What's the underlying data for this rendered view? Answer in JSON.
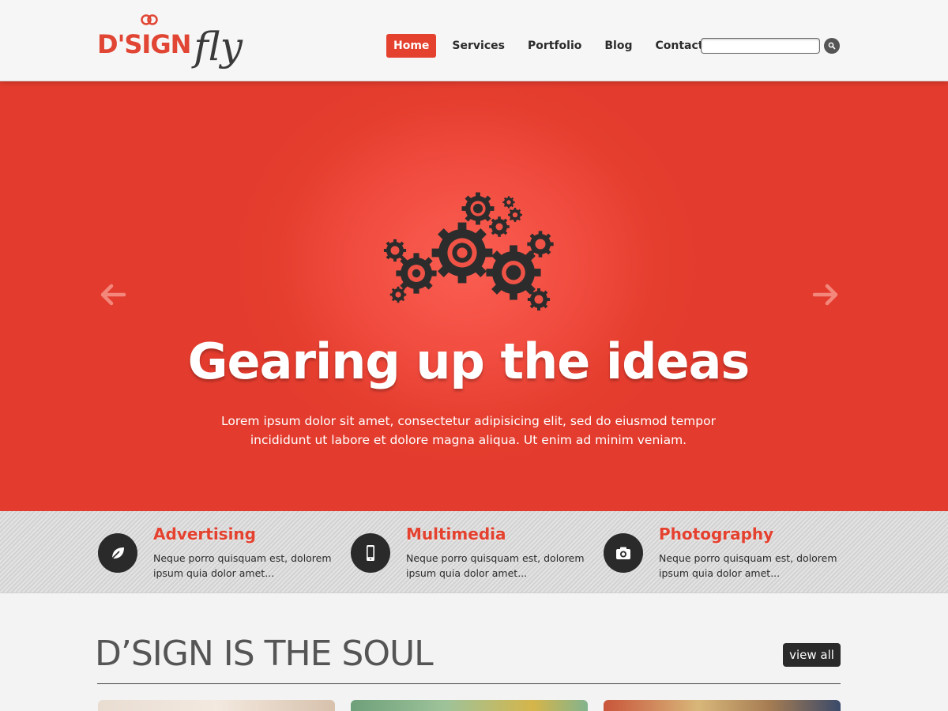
{
  "header": {
    "logo_mark": "D'SIGN",
    "logo_script": "fly",
    "nav": [
      {
        "label": "Home",
        "active": true
      },
      {
        "label": "Services",
        "active": false
      },
      {
        "label": "Portfolio",
        "active": false
      },
      {
        "label": "Blog",
        "active": false
      },
      {
        "label": "Contact",
        "active": false
      }
    ],
    "search": {
      "placeholder": "",
      "value": "",
      "icon": "search-icon"
    }
  },
  "hero": {
    "title": "Gearing up the ideas",
    "text": "Lorem ipsum dolor sit amet, consectetur adipisicing elit, sed do eiusmod tempor incididunt ut labore et dolore magna aliqua. Ut enim ad minim veniam.",
    "icon": "gears-icon",
    "prev_icon": "arrow-left-icon",
    "next_icon": "arrow-right-icon"
  },
  "features": [
    {
      "title": "Advertising",
      "text": "Neque porro quisquam est, dolorem ipsum quia dolor amet...",
      "icon": "leaf-icon"
    },
    {
      "title": "Multimedia",
      "text": "Neque porro quisquam est, dolorem ipsum quia dolor amet...",
      "icon": "smartphone-icon"
    },
    {
      "title": "Photography",
      "text": "Neque porro quisquam est, dolorem ipsum quia dolor amet...",
      "icon": "camera-icon"
    }
  ],
  "section": {
    "title": "D’SIGN IS THE SOUL",
    "view_all": "view all"
  },
  "colors": {
    "accent": "#e4412f",
    "dark": "#2a2a2a",
    "hero_bg": "#e53e2f"
  }
}
